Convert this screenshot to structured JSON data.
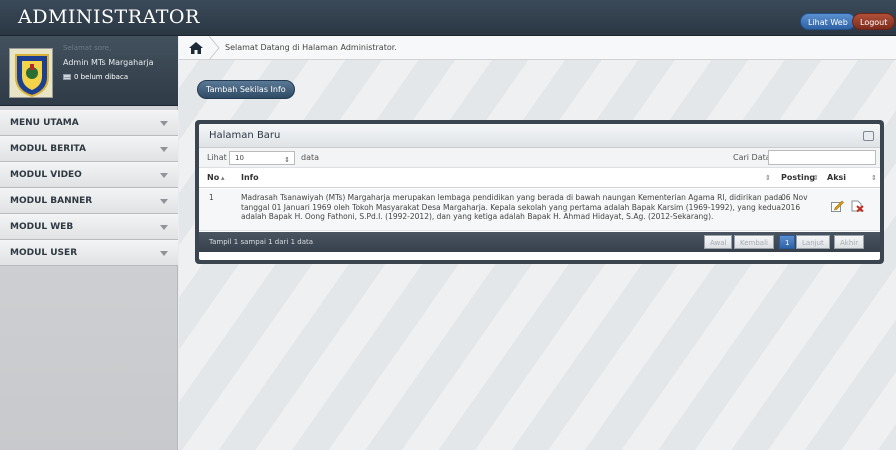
{
  "header": {
    "title": "ADMINISTRATOR",
    "web_button": "Lihat Web",
    "logout_button": "Logout"
  },
  "profile": {
    "greeting": "Selamat sore,",
    "name": "Admin MTs Margaharja",
    "unread": "0 belum dibaca"
  },
  "sidebar": {
    "items": [
      {
        "label": "MENU UTAMA"
      },
      {
        "label": "MODUL BERITA"
      },
      {
        "label": "MODUL VIDEO"
      },
      {
        "label": "MODUL BANNER"
      },
      {
        "label": "MODUL WEB"
      },
      {
        "label": "MODUL USER"
      }
    ]
  },
  "breadcrumb": {
    "text": "Selamat Datang di Halaman Administrator."
  },
  "toolbar": {
    "add_info_button": "Tambah Sekilas Info"
  },
  "panel": {
    "title": "Halaman Baru",
    "show_label": "Lihat",
    "show_value": "10",
    "show_suffix": "data",
    "search_label": "Cari Data:",
    "search_value": "",
    "columns": [
      "No",
      "Info",
      "Posting",
      "Aksi"
    ],
    "rows": [
      {
        "no": "1",
        "info_line1": "Madrasah Tsanawiyah (MTs) Margaharja merupakan lembaga pendidikan yang berada di bawah naungan Kementerian Agama RI, didirikan pada",
        "info_line2": "tanggal 01 Januari 1969 oleh Tokoh Masyarakat Desa Margaharja. Kepala sekolah yang pertama adalah Bapak Karsim (1969-1992), yang kedua",
        "info_line3": "adalah Bapak H. Oong Fathoni, S.Pd.I. (1992-2012), dan yang ketiga adalah Bapak H. Ahmad Hidayat, S.Ag. (2012-Sekarang).",
        "posting_line1": "06 Nov",
        "posting_line2": "2016"
      }
    ],
    "pager_info": "Tampil 1 sampai 1 dari 1 data",
    "pager": {
      "first": "Awal",
      "prev": "Kembali",
      "current": "1",
      "next": "Lanjut",
      "last": "Akhir"
    }
  },
  "colors": {
    "header_bg": "#2f3c48",
    "accent_blue": "#2e62a6",
    "logout_red": "#7e2c1d",
    "edit_icon": "#e0a21c",
    "delete_icon": "#c22a1f"
  }
}
